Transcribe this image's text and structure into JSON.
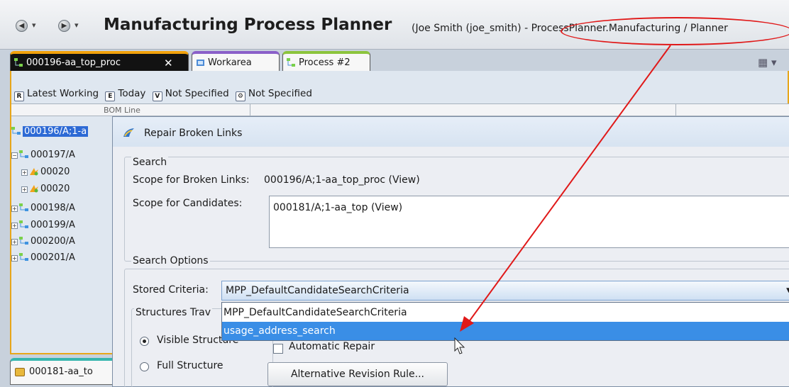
{
  "title_bar": {
    "back_icon": "back-arrow-icon",
    "forward_icon": "forward-arrow-icon",
    "app_title": "Manufacturing Process Planner",
    "user_info": "(Joe Smith (joe_smith) - ProcessPlanner.Manufacturing / Planner"
  },
  "tabs": [
    {
      "label": "000196-aa_top_proc",
      "close": "✕",
      "icon": "process-structure-icon",
      "active": true
    },
    {
      "label": "Workarea",
      "icon": "workarea-icon"
    },
    {
      "label": "Process #2",
      "icon": "process-structure-icon"
    }
  ],
  "revision_bar": [
    {
      "badge": "R",
      "label": "Latest Working"
    },
    {
      "badge": "E",
      "label": "Today"
    },
    {
      "badge": "V",
      "label": "Not Specified"
    },
    {
      "badge": "⚙",
      "label": "Not Specified"
    }
  ],
  "column_header": {
    "first": "BOM Line"
  },
  "tree": [
    {
      "label": "000196/A;1-a",
      "selected": true
    },
    {
      "label": "000197/A",
      "expander": "−"
    },
    {
      "label": "00020",
      "expander": "+"
    },
    {
      "label": "00020",
      "expander": "+"
    },
    {
      "label": "000198/A",
      "expander": "+"
    },
    {
      "label": "000199/A",
      "expander": "+"
    },
    {
      "label": "000200/A",
      "expander": "+"
    },
    {
      "label": "000201/A",
      "expander": "+"
    }
  ],
  "bottom_tab": {
    "label": "000181-aa_to"
  },
  "dialog": {
    "title": "Repair Broken Links",
    "search": {
      "legend": "Search",
      "scope_links_label": "Scope for Broken Links:",
      "scope_links_value": "000196/A;1-aa_top_proc (View)",
      "scope_candidates_label": "Scope for Candidates:",
      "scope_candidates_value": "000181/A;1-aa_top (View)"
    },
    "options": {
      "legend": "Search Options",
      "stored_criteria_label": "Stored Criteria:",
      "stored_criteria_value": "MPP_DefaultCandidateSearchCriteria",
      "dropdown_options": [
        "MPP_DefaultCandidateSearchCriteria",
        "usage_address_search"
      ],
      "highlighted_option": 1,
      "structures_legend": "Structures Trav",
      "radio_visible": "Visible Structure",
      "radio_full": "Full Structure",
      "automatic_repair": "Automatic Repair",
      "alt_revision_button": "Alternative Revision Rule..."
    }
  },
  "annotation_color": "#e01919"
}
